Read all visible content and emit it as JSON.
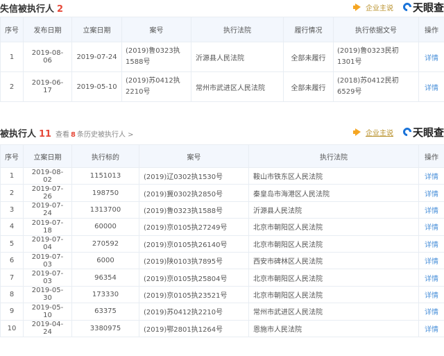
{
  "section1": {
    "title": "失信被执行人",
    "count": "2",
    "brand": {
      "enterprise_say": "企业主说",
      "logo_text": "天眼查"
    },
    "columns": [
      "序号",
      "发布日期",
      "立案日期",
      "案号",
      "执行法院",
      "履行情况",
      "执行依据文号",
      "操作"
    ],
    "rows": [
      {
        "no": "1",
        "publish_date": "2019-08-06",
        "filing_date": "2019-07-24",
        "case_no": "(2019)鲁0323执1588号",
        "court": "沂源县人民法院",
        "status": "全部未履行",
        "basis_no": "(2019)鲁0323民初1301号",
        "action": "详情"
      },
      {
        "no": "2",
        "publish_date": "2019-06-17",
        "filing_date": "2019-05-10",
        "case_no": "(2019)苏0412执2210号",
        "court": "常州市武进区人民法院",
        "status": "全部未履行",
        "basis_no": "(2018)苏0412民初6529号",
        "action": "详情"
      }
    ]
  },
  "section2": {
    "title": "被执行人",
    "count": "11",
    "history": {
      "prefix": "查看",
      "num": "8",
      "suffix": "条历史被执行人 >"
    },
    "brand": {
      "enterprise_say": "企业主说",
      "logo_text": "天眼查"
    },
    "columns": [
      "序号",
      "立案日期",
      "执行标的",
      "案号",
      "执行法院",
      "操作"
    ],
    "rows": [
      {
        "no": "1",
        "filing_date": "2019-08-02",
        "amount": "1151013",
        "case_no": "(2019)辽0302执1530号",
        "court": "鞍山市铁东区人民法院",
        "action": "详情"
      },
      {
        "no": "2",
        "filing_date": "2019-07-26",
        "amount": "198750",
        "case_no": "(2019)冀0302执2850号",
        "court": "秦皇岛市海港区人民法院",
        "action": "详情"
      },
      {
        "no": "3",
        "filing_date": "2019-07-24",
        "amount": "1313700",
        "case_no": "(2019)鲁0323执1588号",
        "court": "沂源县人民法院",
        "action": "详情"
      },
      {
        "no": "4",
        "filing_date": "2019-07-18",
        "amount": "60000",
        "case_no": "(2019)京0105执27249号",
        "court": "北京市朝阳区人民法院",
        "action": "详情"
      },
      {
        "no": "5",
        "filing_date": "2019-07-04",
        "amount": "270592",
        "case_no": "(2019)京0105执26140号",
        "court": "北京市朝阳区人民法院",
        "action": "详情"
      },
      {
        "no": "6",
        "filing_date": "2019-07-03",
        "amount": "6000",
        "case_no": "(2019)陕0103执7895号",
        "court": "西安市碑林区人民法院",
        "action": "详情"
      },
      {
        "no": "7",
        "filing_date": "2019-07-03",
        "amount": "96354",
        "case_no": "(2019)京0105执25804号",
        "court": "北京市朝阳区人民法院",
        "action": "详情"
      },
      {
        "no": "8",
        "filing_date": "2019-05-30",
        "amount": "173330",
        "case_no": "(2019)京0105执23521号",
        "court": "北京市朝阳区人民法院",
        "action": "详情"
      },
      {
        "no": "9",
        "filing_date": "2019-05-10",
        "amount": "63375",
        "case_no": "(2019)苏0412执2210号",
        "court": "常州市武进区人民法院",
        "action": "详情"
      },
      {
        "no": "10",
        "filing_date": "2019-04-24",
        "amount": "3380975",
        "case_no": "(2019)鄂2801执1264号",
        "court": "恩施市人民法院",
        "action": "详情"
      }
    ]
  }
}
